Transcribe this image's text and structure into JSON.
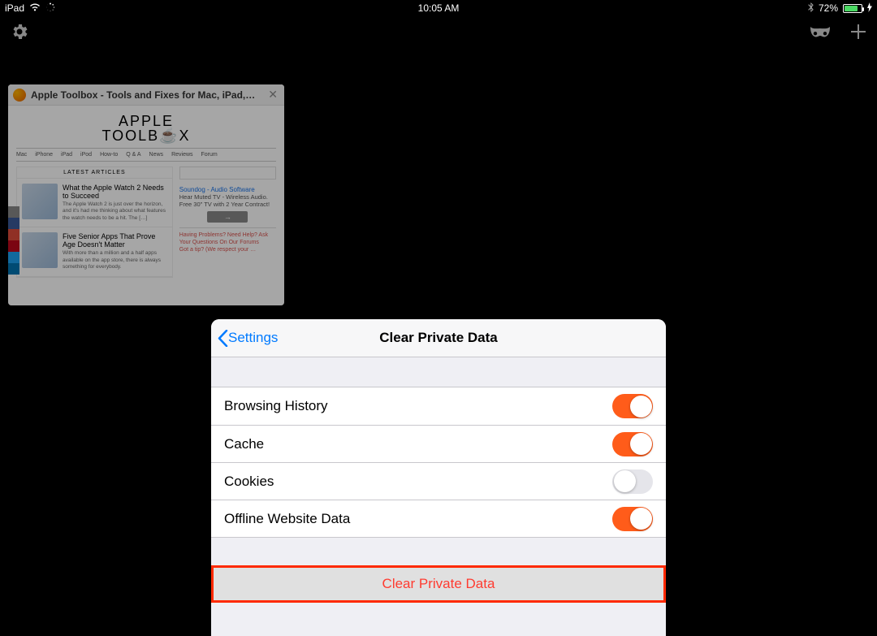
{
  "status_bar": {
    "device": "iPad",
    "time": "10:05 AM",
    "battery_pct": "72%",
    "battery_fill": 72
  },
  "tab": {
    "title": "Apple Toolbox - Tools and Fixes for Mac, iPad,…",
    "page_title_1": "APPLE",
    "page_title_2": "TOOLB☕X",
    "menu": [
      "Mac",
      "iPhone",
      "iPad",
      "iPod",
      "How-to",
      "Q & A",
      "News",
      "Reviews",
      "Forum"
    ],
    "latest_label": "LATEST ARTICLES",
    "articles": [
      {
        "headline": "What the Apple Watch 2 Needs to Succeed",
        "blurb": "The Apple Watch 2 is just over the horizon, and it's had me thinking about what features the watch needs to be a hit. The […]"
      },
      {
        "headline": "Five Senior Apps That Prove Age Doesn't Matter",
        "blurb": "With more than a million and a half apps available on the app store, there is always something for everybody."
      }
    ],
    "ad": {
      "title": "Soundog - Audio Software",
      "line1": "Hear Muted TV - Wireless Audio. Free 30\" TV with 2 Year Contract!",
      "footer1": "Having Problems? Need Help? Ask Your Questions On Our Forums",
      "footer2": "Got a tip? (We respect your …"
    }
  },
  "modal": {
    "back_label": "Settings",
    "title": "Clear Private Data",
    "options": [
      {
        "label": "Browsing History",
        "on": true
      },
      {
        "label": "Cache",
        "on": true
      },
      {
        "label": "Cookies",
        "on": false
      },
      {
        "label": "Offline Website Data",
        "on": true
      }
    ],
    "clear_button": "Clear Private Data"
  },
  "colors": {
    "accent_toggle": "#ff5c1a",
    "ios_blue": "#007aff",
    "destructive": "#ff3b30"
  }
}
